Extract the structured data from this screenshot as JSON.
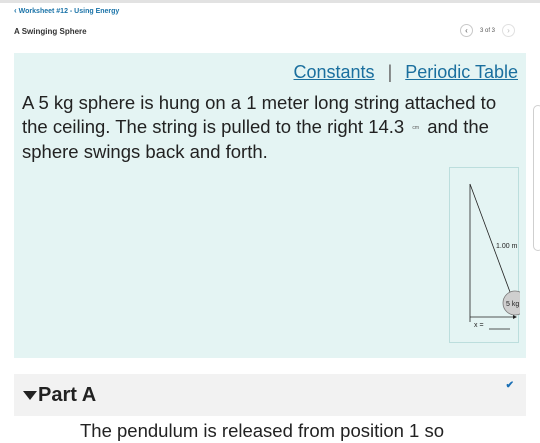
{
  "nav": {
    "back_icon": "chevron-left-icon",
    "back_label": "Worksheet #12 - Using Energy"
  },
  "page": {
    "title": "A Swinging Sphere"
  },
  "pager": {
    "prev_icon": "chevron-left-icon",
    "count": "3 of 3",
    "next_icon": "chevron-right-icon"
  },
  "problem": {
    "links": {
      "constants": "Constants",
      "separator": "|",
      "periodic_table": "Periodic Table"
    },
    "statement_part1": "A 5 kg sphere is hung on a 1 meter long string attached to the ceiling. The string is pulled to the right 14.3",
    "statement_unit": "cm",
    "statement_part2": "and the sphere swings back and forth.",
    "figure": {
      "length_label": "1.00 m",
      "mass_label": "5 kg",
      "x_label": "x ="
    }
  },
  "part_a": {
    "label": "Part A",
    "collapse_icon": "triangle-down-icon",
    "status_icon": "checkmark-icon",
    "text_partial": "The pendulum is released from position 1 so"
  },
  "colors": {
    "link": "#1a6f9e",
    "panel_bg": "#e4f4f3",
    "part_bg": "#f2f2f2"
  }
}
